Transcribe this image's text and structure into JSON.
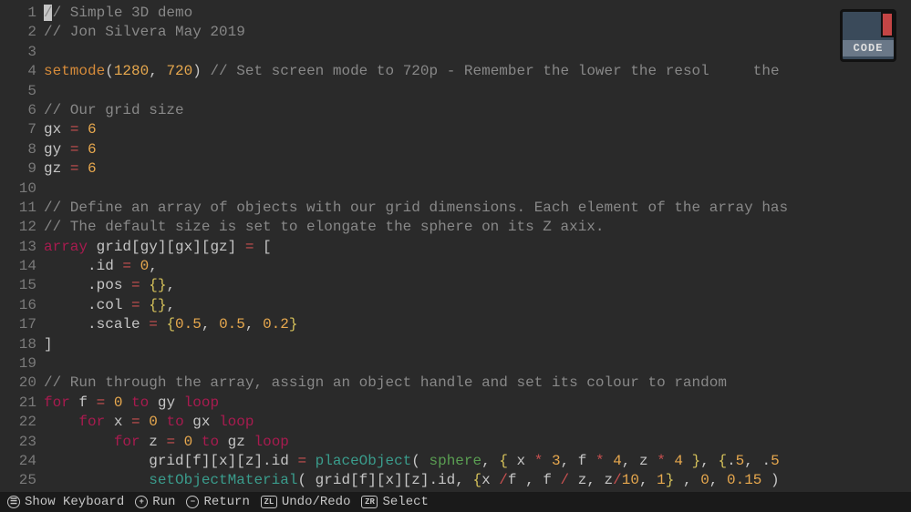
{
  "gutter": {
    "start": 1,
    "end": 25
  },
  "book": {
    "label": "CODE"
  },
  "statusbar": {
    "items": [
      {
        "icon": "☰",
        "label": "Show Keyboard",
        "shape": "round"
      },
      {
        "icon": "+",
        "label": "Run",
        "shape": "round"
      },
      {
        "icon": "−",
        "label": "Return",
        "shape": "round"
      },
      {
        "icon": "ZL",
        "label": "Undo/Redo",
        "shape": "rect"
      },
      {
        "icon": "ZR",
        "label": "Select",
        "shape": "rect"
      }
    ]
  },
  "code": {
    "lines": [
      [
        {
          "t": "cursor"
        },
        {
          "c": "c-comment",
          "t": "// Simple 3D demo"
        }
      ],
      [
        {
          "c": "c-comment",
          "t": "// Jon Silvera May 2019"
        }
      ],
      [],
      [
        {
          "c": "c-func",
          "t": "setmode"
        },
        {
          "c": "c-bracket",
          "t": "("
        },
        {
          "c": "c-num",
          "t": "1280"
        },
        {
          "c": "c-bracket",
          "t": ", "
        },
        {
          "c": "c-num",
          "t": "720"
        },
        {
          "c": "c-bracket",
          "t": ") "
        },
        {
          "c": "c-comment",
          "t": "// Set screen mode to 720p - Remember the lower the resol     the"
        }
      ],
      [],
      [
        {
          "c": "c-comment",
          "t": "// Our grid size"
        }
      ],
      [
        {
          "c": "",
          "t": "gx "
        },
        {
          "c": "c-op",
          "t": "="
        },
        {
          "c": "",
          "t": " "
        },
        {
          "c": "c-num",
          "t": "6"
        }
      ],
      [
        {
          "c": "",
          "t": "gy "
        },
        {
          "c": "c-op",
          "t": "="
        },
        {
          "c": "",
          "t": " "
        },
        {
          "c": "c-num",
          "t": "6"
        }
      ],
      [
        {
          "c": "",
          "t": "gz "
        },
        {
          "c": "c-op",
          "t": "="
        },
        {
          "c": "",
          "t": " "
        },
        {
          "c": "c-num",
          "t": "6"
        }
      ],
      [],
      [
        {
          "c": "c-comment",
          "t": "// Define an array of objects with our grid dimensions. Each element of the array has"
        }
      ],
      [
        {
          "c": "c-comment",
          "t": "// The default size is set to elongate the sphere on its Z axix."
        }
      ],
      [
        {
          "c": "c-keyword",
          "t": "array"
        },
        {
          "c": "",
          "t": " grid[gy][gx][gz] "
        },
        {
          "c": "c-op",
          "t": "="
        },
        {
          "c": "",
          "t": " ["
        }
      ],
      [
        {
          "c": "",
          "t": "     .id "
        },
        {
          "c": "c-op",
          "t": "="
        },
        {
          "c": "",
          "t": " "
        },
        {
          "c": "c-num",
          "t": "0"
        },
        {
          "c": "",
          "t": ","
        }
      ],
      [
        {
          "c": "",
          "t": "     .pos "
        },
        {
          "c": "c-op",
          "t": "="
        },
        {
          "c": "",
          "t": " "
        },
        {
          "c": "c-brace",
          "t": "{}"
        },
        {
          "c": "",
          "t": ","
        }
      ],
      [
        {
          "c": "",
          "t": "     .col "
        },
        {
          "c": "c-op",
          "t": "="
        },
        {
          "c": "",
          "t": " "
        },
        {
          "c": "c-brace",
          "t": "{}"
        },
        {
          "c": "",
          "t": ","
        }
      ],
      [
        {
          "c": "",
          "t": "     .scale "
        },
        {
          "c": "c-op",
          "t": "="
        },
        {
          "c": "",
          "t": " "
        },
        {
          "c": "c-brace",
          "t": "{"
        },
        {
          "c": "c-num",
          "t": "0.5"
        },
        {
          "c": "",
          "t": ", "
        },
        {
          "c": "c-num",
          "t": "0.5"
        },
        {
          "c": "",
          "t": ", "
        },
        {
          "c": "c-num",
          "t": "0.2"
        },
        {
          "c": "c-brace",
          "t": "}"
        }
      ],
      [
        {
          "c": "",
          "t": "]"
        }
      ],
      [],
      [
        {
          "c": "c-comment",
          "t": "// Run through the array, assign an object handle and set its colour to random"
        }
      ],
      [
        {
          "c": "c-keyword",
          "t": "for"
        },
        {
          "c": "",
          "t": " f "
        },
        {
          "c": "c-op",
          "t": "="
        },
        {
          "c": "",
          "t": " "
        },
        {
          "c": "c-num",
          "t": "0"
        },
        {
          "c": "",
          "t": " "
        },
        {
          "c": "c-keyword",
          "t": "to"
        },
        {
          "c": "",
          "t": " gy "
        },
        {
          "c": "c-keyword",
          "t": "loop"
        }
      ],
      [
        {
          "c": "",
          "t": "    "
        },
        {
          "c": "c-keyword",
          "t": "for"
        },
        {
          "c": "",
          "t": " x "
        },
        {
          "c": "c-op",
          "t": "="
        },
        {
          "c": "",
          "t": " "
        },
        {
          "c": "c-num",
          "t": "0"
        },
        {
          "c": "",
          "t": " "
        },
        {
          "c": "c-keyword",
          "t": "to"
        },
        {
          "c": "",
          "t": " gx "
        },
        {
          "c": "c-keyword",
          "t": "loop"
        }
      ],
      [
        {
          "c": "",
          "t": "        "
        },
        {
          "c": "c-keyword",
          "t": "for"
        },
        {
          "c": "",
          "t": " z "
        },
        {
          "c": "c-op",
          "t": "="
        },
        {
          "c": "",
          "t": " "
        },
        {
          "c": "c-num",
          "t": "0"
        },
        {
          "c": "",
          "t": " "
        },
        {
          "c": "c-keyword",
          "t": "to"
        },
        {
          "c": "",
          "t": " gz "
        },
        {
          "c": "c-keyword",
          "t": "loop"
        }
      ],
      [
        {
          "c": "",
          "t": "            grid[f][x][z].id "
        },
        {
          "c": "c-op",
          "t": "="
        },
        {
          "c": "",
          "t": " "
        },
        {
          "c": "c-call",
          "t": "placeObject"
        },
        {
          "c": "c-bracket",
          "t": "( "
        },
        {
          "c": "c-ident",
          "t": "sphere"
        },
        {
          "c": "c-bracket",
          "t": ", "
        },
        {
          "c": "c-brace",
          "t": "{"
        },
        {
          "c": "",
          "t": " x "
        },
        {
          "c": "c-op",
          "t": "*"
        },
        {
          "c": "",
          "t": " "
        },
        {
          "c": "c-num",
          "t": "3"
        },
        {
          "c": "",
          "t": ", f "
        },
        {
          "c": "c-op",
          "t": "*"
        },
        {
          "c": "",
          "t": " "
        },
        {
          "c": "c-num",
          "t": "4"
        },
        {
          "c": "",
          "t": ", z "
        },
        {
          "c": "c-op",
          "t": "*"
        },
        {
          "c": "",
          "t": " "
        },
        {
          "c": "c-num",
          "t": "4"
        },
        {
          "c": "",
          "t": " "
        },
        {
          "c": "c-brace",
          "t": "}"
        },
        {
          "c": "",
          "t": ", "
        },
        {
          "c": "c-brace",
          "t": "{"
        },
        {
          "c": "",
          "t": "."
        },
        {
          "c": "c-num",
          "t": "5"
        },
        {
          "c": "",
          "t": ", ."
        },
        {
          "c": "c-num",
          "t": "5"
        }
      ],
      [
        {
          "c": "",
          "t": "            "
        },
        {
          "c": "c-call",
          "t": "setObjectMaterial"
        },
        {
          "c": "c-bracket",
          "t": "( "
        },
        {
          "c": "",
          "t": "grid[f][x][z].id, "
        },
        {
          "c": "c-brace",
          "t": "{"
        },
        {
          "c": "",
          "t": "x "
        },
        {
          "c": "c-op",
          "t": "/"
        },
        {
          "c": "",
          "t": "f , f "
        },
        {
          "c": "c-op",
          "t": "/"
        },
        {
          "c": "",
          "t": " z, z"
        },
        {
          "c": "c-op",
          "t": "/"
        },
        {
          "c": "c-num",
          "t": "10"
        },
        {
          "c": "",
          "t": ", "
        },
        {
          "c": "c-num",
          "t": "1"
        },
        {
          "c": "c-brace",
          "t": "}"
        },
        {
          "c": "",
          "t": " , "
        },
        {
          "c": "c-num",
          "t": "0"
        },
        {
          "c": "",
          "t": ", "
        },
        {
          "c": "c-num",
          "t": "0.15"
        },
        {
          "c": "",
          "t": " )"
        }
      ]
    ]
  }
}
